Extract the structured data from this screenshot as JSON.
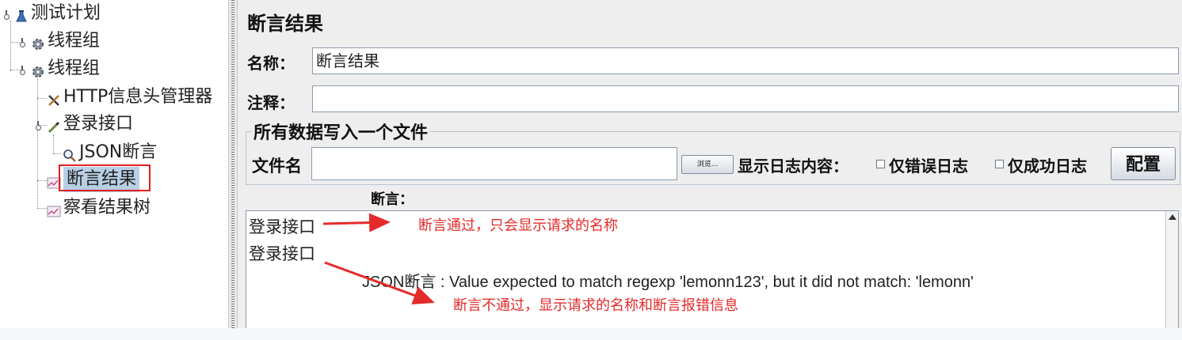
{
  "tree": {
    "items": [
      {
        "label": "测试计划",
        "icon": "flask-icon"
      },
      {
        "label": "线程组",
        "icon": "gear-icon"
      },
      {
        "label": "线程组",
        "icon": "gear-icon"
      },
      {
        "label": "HTTP信息头管理器",
        "icon": "tools-icon"
      },
      {
        "label": "登录接口",
        "icon": "pipette-icon"
      },
      {
        "label": "JSON断言",
        "icon": "magnifier-icon"
      },
      {
        "label": "断言结果",
        "icon": "chart-icon"
      },
      {
        "label": "察看结果树",
        "icon": "chart-icon"
      }
    ]
  },
  "panel": {
    "title": "断言结果",
    "name_label": "名称：",
    "name_value": "断言结果",
    "comment_label": "注释：",
    "comment_value": "",
    "file_group_title": "所有数据写入一个文件",
    "filename_label": "文件名",
    "filename_value": "",
    "browse_label": "浏览...",
    "log_label": "显示日志内容：",
    "errors_only_label": "仅错误日志",
    "success_only_label": "仅成功日志",
    "config_label": "配置",
    "assertion_label": "断言："
  },
  "results": {
    "lines": [
      "登录接口",
      "登录接口",
      "JSON断言 : Value expected to match regexp 'lemonn123', but it did not match: 'lemonn'"
    ]
  },
  "annotations": {
    "pass_note": "断言通过，只会显示请求的名称",
    "fail_note": "断言不通过，显示请求的名称和断言报错信息",
    "color": "#e52a2a"
  }
}
